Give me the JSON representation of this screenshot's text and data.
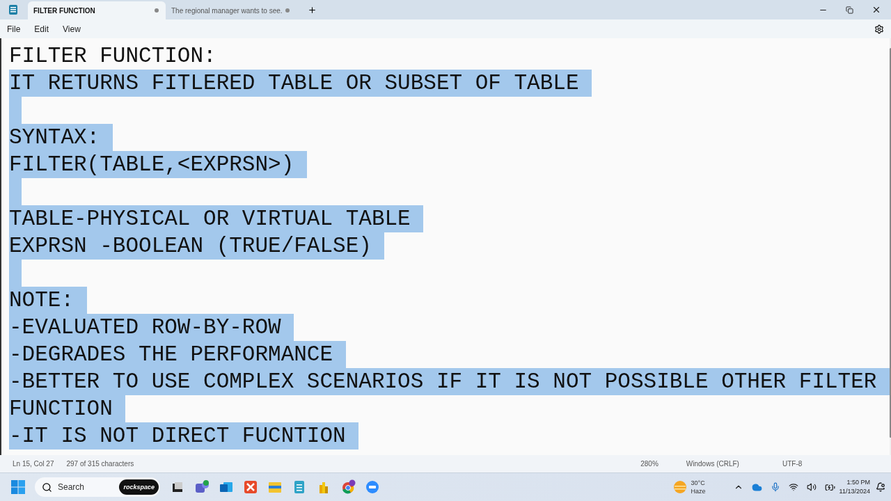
{
  "tabs": [
    {
      "label": "FILTER FUNCTION",
      "selected": true,
      "unsaved": true
    },
    {
      "label": "The regional manager wants to see.",
      "selected": false,
      "unsaved": true
    }
  ],
  "menu": [
    "File",
    "Edit",
    "View"
  ],
  "editor": {
    "lines": [
      {
        "kind": "text",
        "text": "FILTER FUNCTION:",
        "selected": false
      },
      {
        "kind": "text",
        "text": "IT RETURNS FITLERED TABLE OR SUBSET OF TABLE",
        "selected": true
      },
      {
        "kind": "blank",
        "selected": true
      },
      {
        "kind": "text",
        "text": "SYNTAX:",
        "selected": true
      },
      {
        "kind": "text",
        "text": "FILTER(TABLE,<EXPRSN>)",
        "selected": true
      },
      {
        "kind": "blank",
        "selected": true
      },
      {
        "kind": "text",
        "text": "TABLE-PHYSICAL OR VIRTUAL TABLE",
        "selected": true
      },
      {
        "kind": "text",
        "text": "EXPRSN -BOOLEAN (TRUE/FALSE)",
        "selected": true
      },
      {
        "kind": "blank",
        "selected": true
      },
      {
        "kind": "text",
        "text": "NOTE:",
        "selected": true
      },
      {
        "kind": "text",
        "text": "-EVALUATED ROW-BY-ROW",
        "selected": true
      },
      {
        "kind": "text",
        "text": "-DEGRADES THE PERFORMANCE",
        "selected": true
      },
      {
        "kind": "text",
        "text": "-BETTER TO USE COMPLEX SCENARIOS IF IT IS NOT POSSIBLE OTHER FILTER",
        "selected": true
      },
      {
        "kind": "text",
        "text": "FUNCTION",
        "selected": true
      },
      {
        "kind": "text",
        "text": "-IT IS NOT DIRECT FUCNTION",
        "selected": true
      }
    ]
  },
  "status_bar": {
    "position": "Ln 15, Col 27",
    "count": "297 of 315 characters",
    "zoom": "280%",
    "line_ending": "Windows (CRLF)",
    "encoding": "UTF-8"
  },
  "taskbar": {
    "search": {
      "placeholder": "Search"
    },
    "search_badge": "rockspace",
    "weather": {
      "temp": "30°C",
      "condition": "Haze"
    },
    "time": "1:50 PM",
    "date": "11/13/2024"
  }
}
